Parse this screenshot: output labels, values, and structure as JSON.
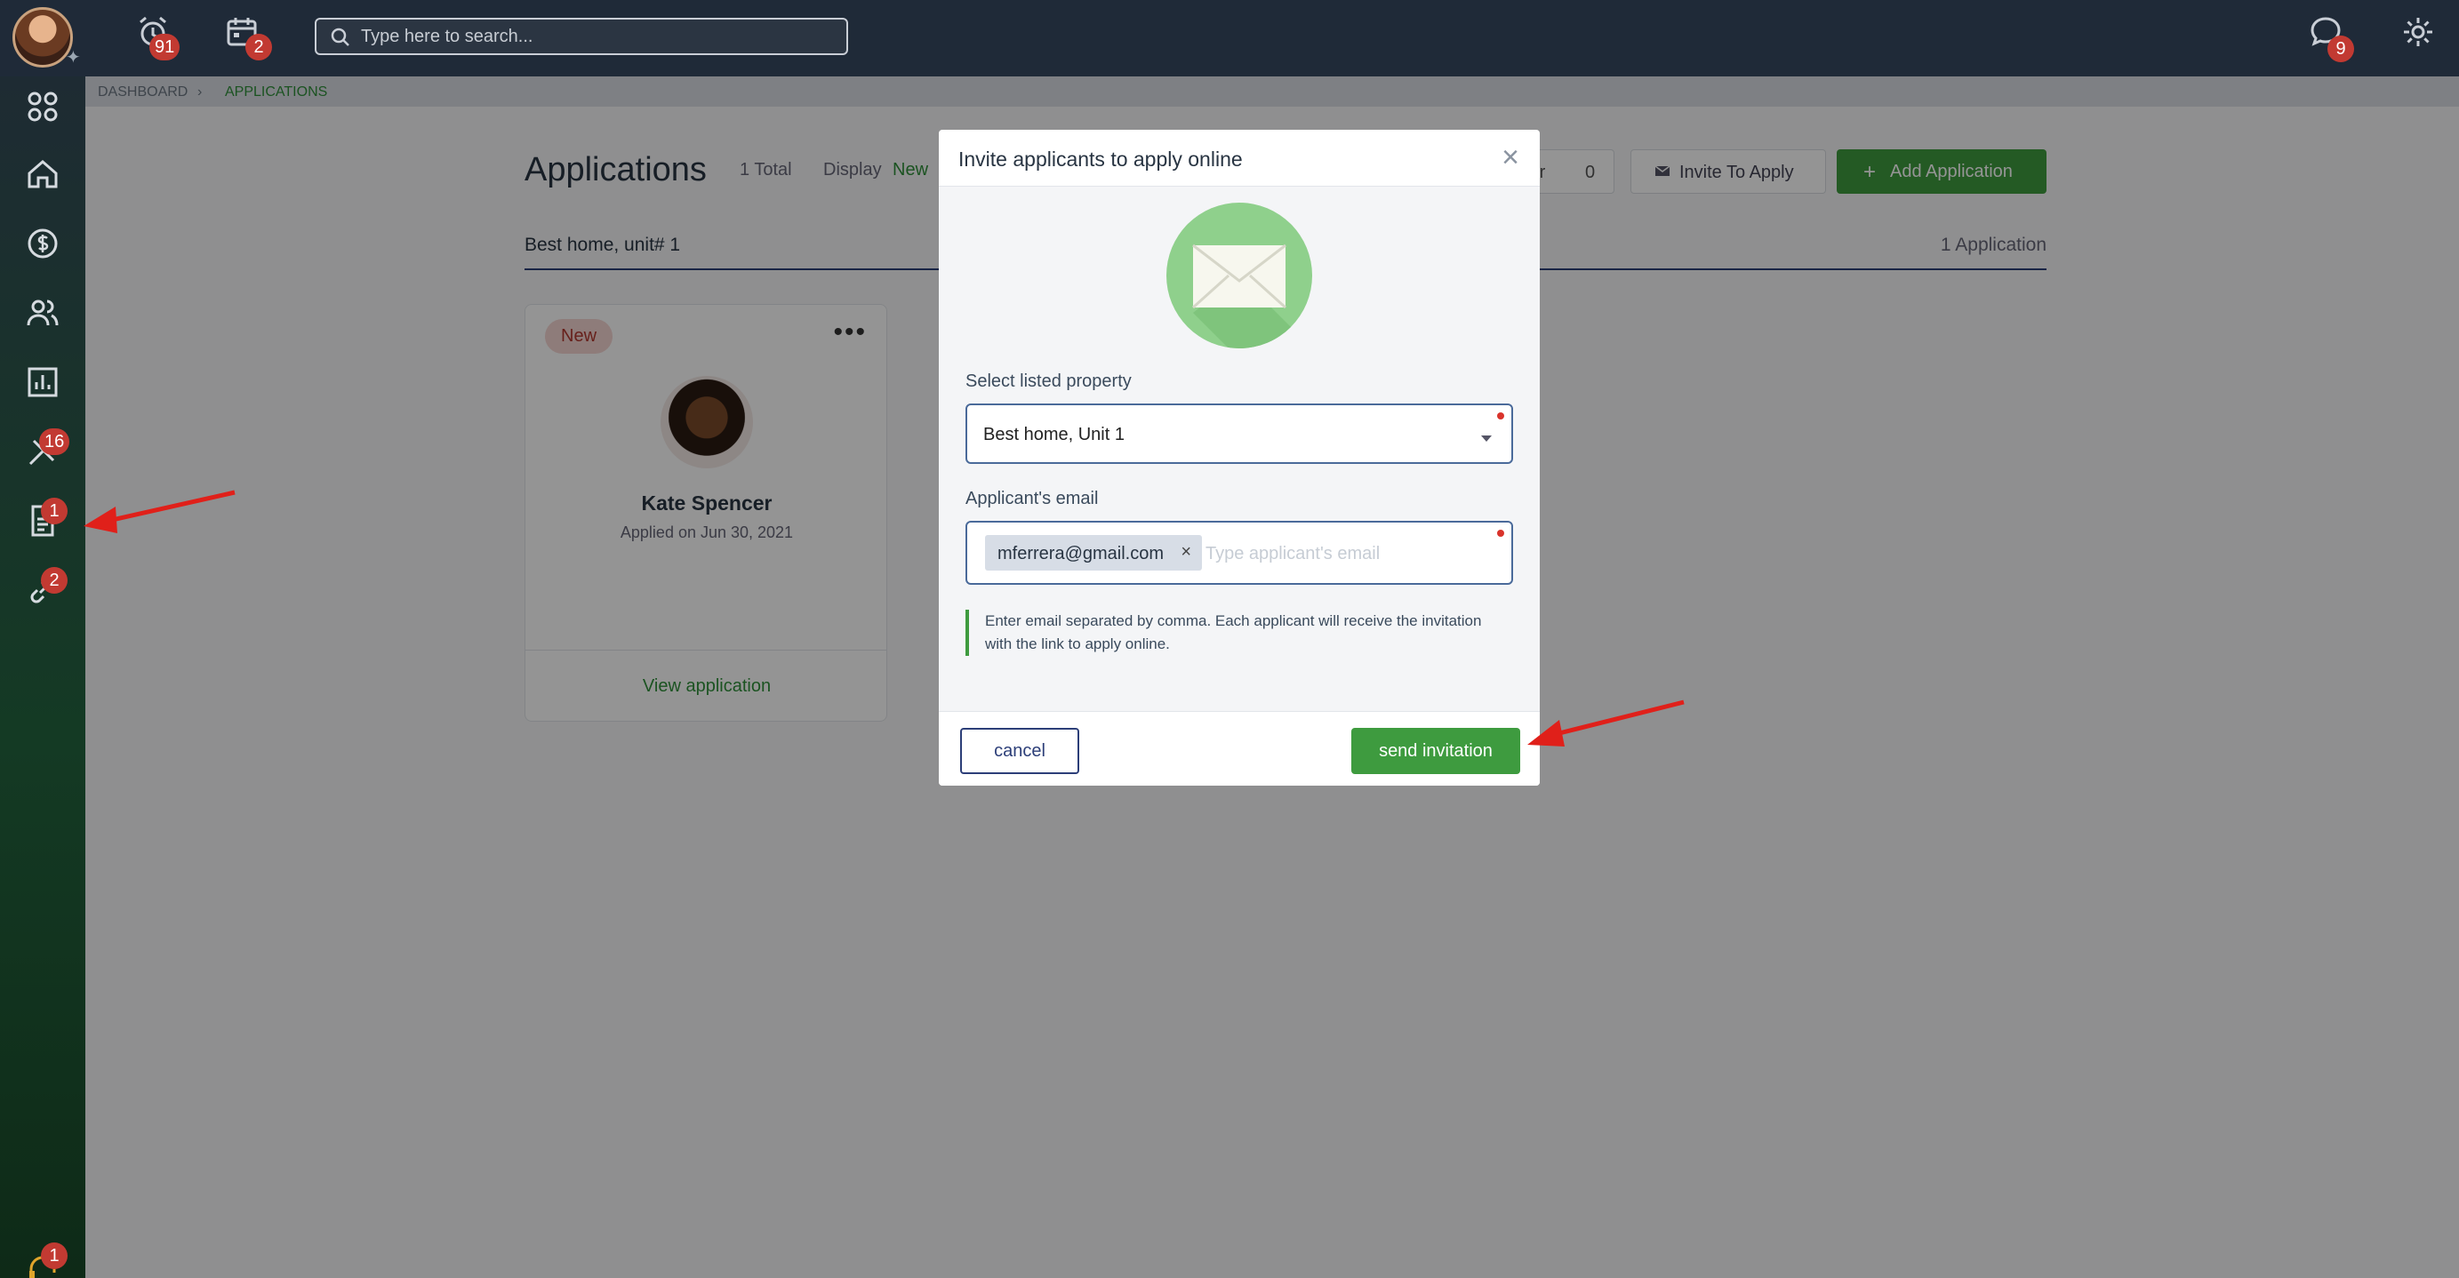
{
  "topbar": {
    "search_placeholder": "Type here to search...",
    "alarms_badge": "91",
    "calendar_badge": "2",
    "messages_badge": "9"
  },
  "sidebar": {
    "tools_badge": "16",
    "applications_badge": "1",
    "links_badge": "2",
    "support_badge": "1"
  },
  "breadcrumb": {
    "items": [
      "DASHBOARD",
      "APPLICATIONS"
    ]
  },
  "main": {
    "title": "Applications",
    "total": "1 Total",
    "display_label": "Display",
    "display_value": "New",
    "filter_label": "ter",
    "filter_count": "0",
    "invite_button": "Invite To Apply",
    "add_button": "Add Application",
    "property_name": "Best home, unit# 1",
    "application_count": "1 Application",
    "card": {
      "status": "New",
      "name": "Kate Spencer",
      "applied": "Applied on Jun 30, 2021",
      "view_link": "View application"
    }
  },
  "modal": {
    "title": "Invite applicants to apply online",
    "property_label": "Select listed property",
    "property_value": "Best home, Unit 1",
    "email_label": "Applicant's email",
    "email_chip": "mferrera@gmail.com",
    "email_placeholder": "Type applicant's email",
    "note": "Enter email separated by comma. Each applicant will receive the invitation with the link to apply online.",
    "cancel": "cancel",
    "send": "send invitation"
  },
  "colors": {
    "topbar": "#1f2a38",
    "accent_green": "#3e9b3f",
    "badge_red": "#c23a32",
    "navy": "#2c3e78"
  }
}
